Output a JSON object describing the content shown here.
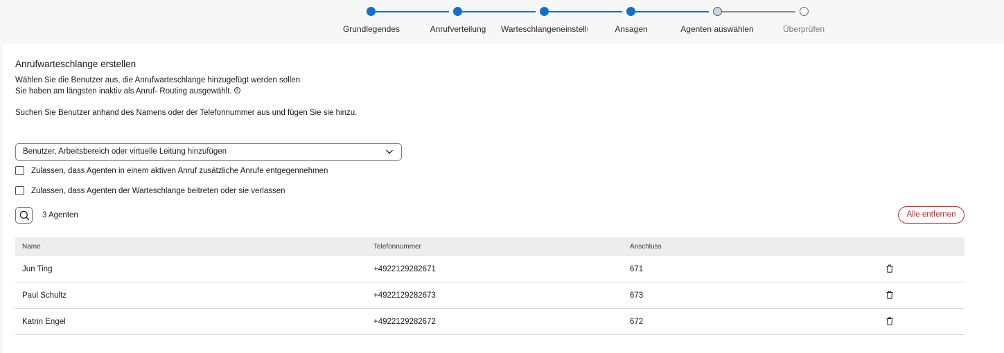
{
  "stepper": {
    "steps": [
      {
        "label": "Grundlegendes",
        "state": "done"
      },
      {
        "label": "Anrufverteilung",
        "state": "done"
      },
      {
        "label": "Warteschlangeneinstellungen",
        "state": "done"
      },
      {
        "label": "Ansagen",
        "state": "done"
      },
      {
        "label": "Agenten auswählen",
        "state": "current"
      },
      {
        "label": "Überprüfen",
        "state": "todo"
      }
    ]
  },
  "main": {
    "title": "Anrufwarteschlange erstellen",
    "desc1": "Wählen Sie die Benutzer aus, die Anrufwarteschlange hinzugefügt werden sollen",
    "desc2": "Sie haben am längsten inaktiv als Anruf- Routing ausgewählt.",
    "info_icon_glyph": "i",
    "desc3": "Suchen Sie Benutzer anhand des Namens oder der Telefonnummer aus und fügen Sie sie hinzu.",
    "dropdown_placeholder": "Benutzer, Arbeitsbereich oder virtuelle Leitung hinzufügen",
    "checkbox1": "Zulassen, dass Agenten in einem aktiven Anruf zusätzliche Anrufe entgegennehmen",
    "checkbox2": "Zulassen, dass Agenten der Warteschlange beitreten oder sie verlassen",
    "agents_count": "3 Agenten",
    "remove_all": "Alle entfernen"
  },
  "table": {
    "columns": {
      "name": "Name",
      "phone": "Telefonnummer",
      "ext": "Anschluss"
    },
    "rows": [
      {
        "name": "Jun Ting",
        "phone": "+4922129282671",
        "ext": "671"
      },
      {
        "name": "Paul Schultz",
        "phone": "+4922129282673",
        "ext": "673"
      },
      {
        "name": "Katrin Engel",
        "phone": "+4922129282672",
        "ext": "672"
      }
    ]
  },
  "colors": {
    "accent": "#1170cf",
    "danger": "#c0272d"
  },
  "icons": [
    "chevron-down-icon",
    "search-icon",
    "trash-icon",
    "info-icon"
  ]
}
